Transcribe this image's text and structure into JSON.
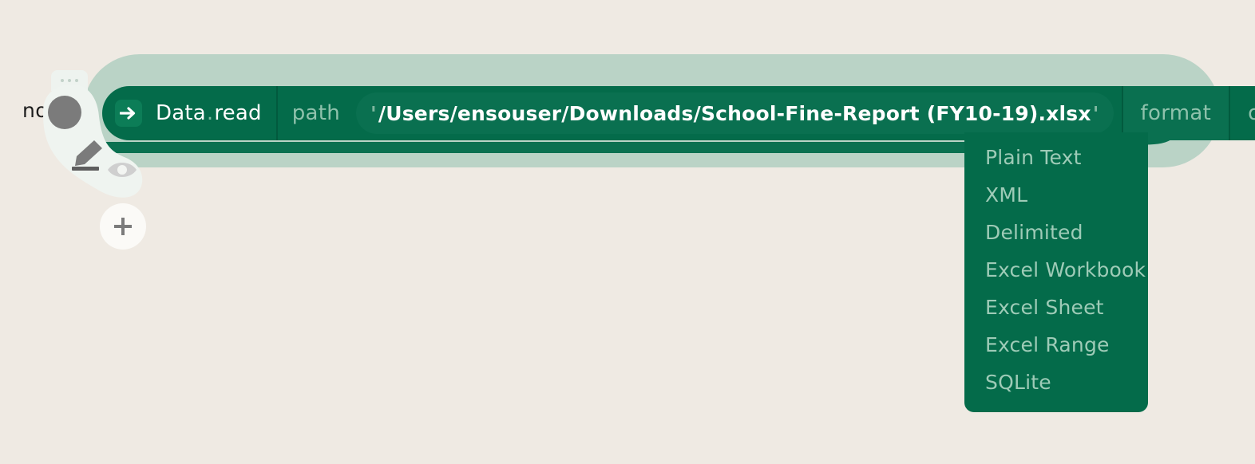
{
  "canvas": {
    "background_color": "#efeae3",
    "halo_color": "#bad3c6",
    "node_color": "#046b4a",
    "accent_color": "#0a7050"
  },
  "background_label": {
    "text": "no"
  },
  "node": {
    "icon": "arrow-right-icon",
    "title": "Data",
    "separator": ".",
    "method": "read",
    "parameters": [
      {
        "name": "path",
        "has_value": true,
        "open_quote": "'",
        "value": "/Users/ensouser/Downloads/School-Fine-Report (FY10-19).xlsx",
        "close_quote": "'"
      },
      {
        "name": "format",
        "has_value": false,
        "active": true
      },
      {
        "name": "on_problems",
        "has_value": false,
        "active": false
      }
    ]
  },
  "dropdown": {
    "open": true,
    "anchor_parameter": "format",
    "options": [
      {
        "label": "Plain Text"
      },
      {
        "label": "XML"
      },
      {
        "label": "Delimited"
      },
      {
        "label": "Excel Workbook"
      },
      {
        "label": "Excel Sheet"
      },
      {
        "label": "Excel Range"
      },
      {
        "label": "SQLite"
      }
    ]
  },
  "tool_widget": {
    "grip_icon": "drag-dots-icon",
    "color_swatch_icon": "color-circle-icon",
    "edit_icon": "pencil-icon",
    "visibility_icon": "eye-icon"
  },
  "add_button": {
    "icon": "plus-icon"
  }
}
